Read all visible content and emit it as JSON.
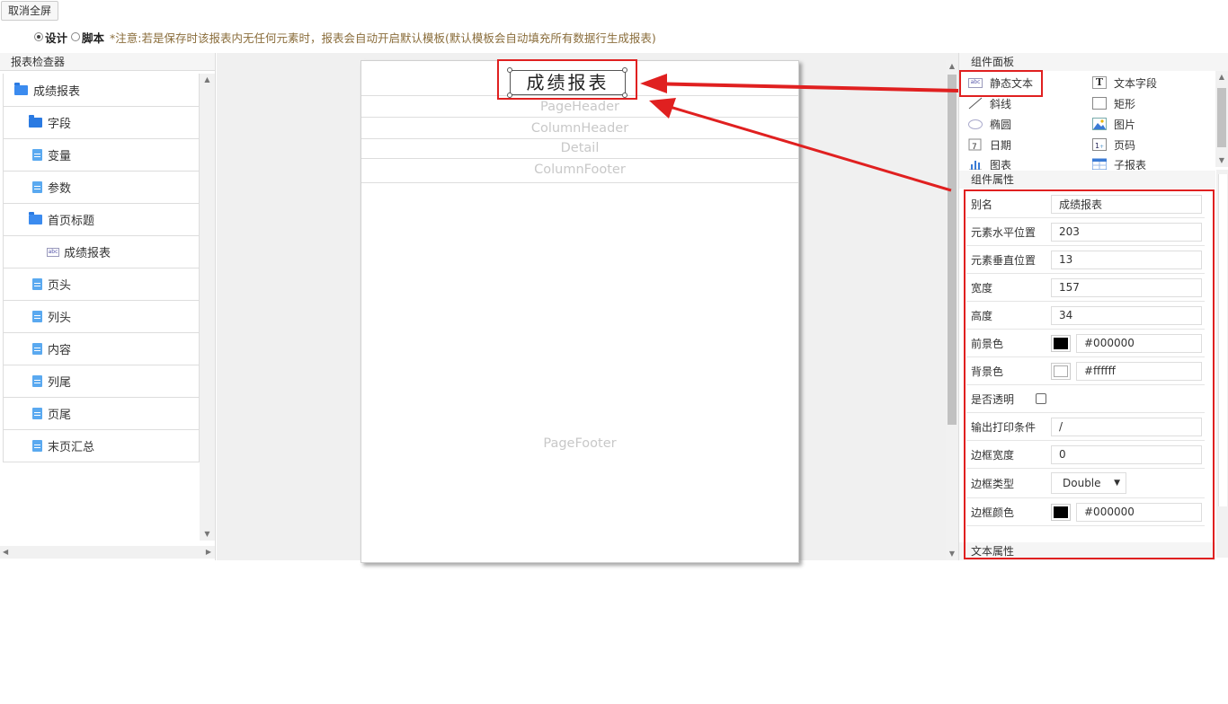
{
  "toolbar": {
    "exit_fullscreen": "取消全屏",
    "mode_design": "设计",
    "mode_script": "脚本",
    "note": "*注意:若是保存时该报表内无任何元素时，报表会自动开启默认模板(默认模板会自动填充所有数据行生成报表)"
  },
  "inspector": {
    "title": "报表检查器",
    "items": [
      {
        "label": "成绩报表",
        "icon": "folder-open-icon"
      },
      {
        "label": "字段",
        "icon": "folder-icon"
      },
      {
        "label": "变量",
        "icon": "document-icon"
      },
      {
        "label": "参数",
        "icon": "document-icon"
      },
      {
        "label": "首页标题",
        "icon": "folder-open-icon"
      },
      {
        "label": "成绩报表",
        "icon": "static-text-icon"
      },
      {
        "label": "页头",
        "icon": "document-icon"
      },
      {
        "label": "列头",
        "icon": "document-icon"
      },
      {
        "label": "内容",
        "icon": "document-icon"
      },
      {
        "label": "列尾",
        "icon": "document-icon"
      },
      {
        "label": "页尾",
        "icon": "document-icon"
      },
      {
        "label": "末页汇总",
        "icon": "document-icon"
      }
    ]
  },
  "canvas": {
    "title_element": "成绩报表",
    "bands": {
      "page_header": "PageHeader",
      "column_header": "ColumnHeader",
      "detail": "Detail",
      "column_footer": "ColumnFooter",
      "page_footer": "PageFooter"
    }
  },
  "components": {
    "title": "组件面板",
    "items": [
      {
        "label": "静态文本",
        "icon": "static-text-icon"
      },
      {
        "label": "文本字段",
        "icon": "text-field-icon"
      },
      {
        "label": "斜线",
        "icon": "line-icon"
      },
      {
        "label": "矩形",
        "icon": "rectangle-icon"
      },
      {
        "label": "椭圆",
        "icon": "ellipse-icon"
      },
      {
        "label": "图片",
        "icon": "image-icon"
      },
      {
        "label": "日期",
        "icon": "calendar-icon"
      },
      {
        "label": "页码",
        "icon": "page-number-icon"
      },
      {
        "label": "图表",
        "icon": "chart-icon"
      },
      {
        "label": "子报表",
        "icon": "subreport-icon"
      }
    ]
  },
  "properties": {
    "title": "组件属性",
    "alias_label": "别名",
    "alias_value": "成绩报表",
    "x_label": "元素水平位置",
    "x_value": "203",
    "y_label": "元素垂直位置",
    "y_value": "13",
    "width_label": "宽度",
    "width_value": "157",
    "height_label": "高度",
    "height_value": "34",
    "fg_label": "前景色",
    "fg_value": "#000000",
    "bg_label": "背景色",
    "bg_value": "#ffffff",
    "transparent_label": "是否透明",
    "print_cond_label": "输出打印条件",
    "print_cond_value": "/",
    "border_width_label": "边框宽度",
    "border_width_value": "0",
    "border_type_label": "边框类型",
    "border_type_value": "Double",
    "border_color_label": "边框颜色",
    "border_color_value": "#000000",
    "text_props_title": "文本属性"
  },
  "colors": {
    "highlight": "#e02020",
    "folder": "#2a7ae2",
    "foreground": "#000000",
    "background": "#ffffff"
  }
}
